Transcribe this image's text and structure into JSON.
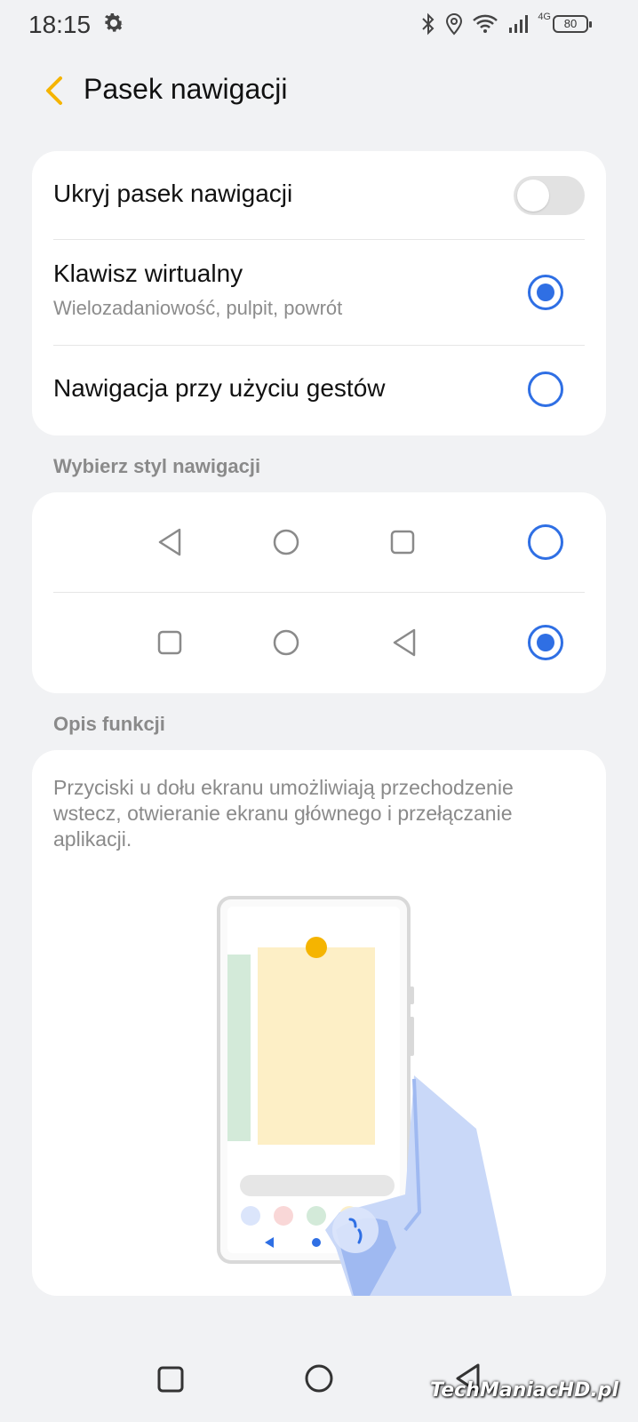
{
  "status_bar": {
    "time": "18:15",
    "network_label": "4G",
    "battery": "80"
  },
  "header": {
    "title": "Pasek nawigacji"
  },
  "settings": {
    "hide_nav_bar": {
      "label": "Ukryj pasek nawigacji",
      "enabled": false
    },
    "virtual_keys": {
      "label": "Klawisz wirtualny",
      "description": "Wielozadaniowość, pulpit, powrót",
      "selected": true
    },
    "gesture_nav": {
      "label": "Nawigacja przy użyciu gestów",
      "selected": false
    }
  },
  "nav_style": {
    "section_label": "Wybierz styl nawigacji",
    "options": [
      {
        "order": [
          "back-icon",
          "home-icon",
          "recents-icon"
        ],
        "selected": false
      },
      {
        "order": [
          "recents-icon",
          "home-icon",
          "back-icon"
        ],
        "selected": true
      }
    ]
  },
  "description": {
    "section_label": "Opis funkcji",
    "text": "Przyciski u dołu ekranu umożliwiają przechodzenie wstecz, otwieranie ekranu głównego i przełączanie aplikacji."
  },
  "system_nav": {
    "buttons": [
      "recents-icon",
      "home-icon",
      "back-icon"
    ]
  },
  "watermark": "TechManiacHD.pl",
  "colors": {
    "accent_blue": "#2f6fe4",
    "back_arrow": "#f5b400",
    "background": "#f1f2f4",
    "card": "#ffffff",
    "toggle_off": "#e2e2e2"
  }
}
